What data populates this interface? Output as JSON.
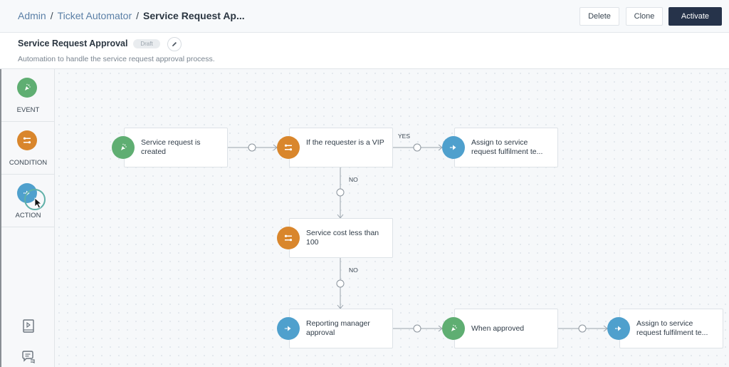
{
  "breadcrumb": {
    "items": [
      "Admin",
      "Ticket Automator"
    ],
    "separator": "/",
    "current": "Service Request Ap..."
  },
  "toolbar": {
    "delete_label": "Delete",
    "clone_label": "Clone",
    "activate_label": "Activate"
  },
  "automation": {
    "title": "Service Request Approval",
    "status_badge": "Draft",
    "description": "Automation to handle the service request approval process."
  },
  "palette": {
    "items": [
      {
        "label": "EVENT",
        "icon": "event-icon",
        "color": "#5fae72"
      },
      {
        "label": "CONDITION",
        "icon": "condition-icon",
        "color": "#d9862c"
      },
      {
        "label": "ACTION",
        "icon": "action-icon",
        "color": "#4fa0cd"
      }
    ],
    "bottom_icons": [
      "playbook-icon",
      "chat-icon"
    ]
  },
  "flow": {
    "nodes": [
      {
        "id": "n1",
        "type": "event",
        "text": "Service request is created"
      },
      {
        "id": "n2",
        "type": "condition",
        "text": "If the requester is a VIP"
      },
      {
        "id": "n3",
        "type": "action",
        "text": "Assign to service request fulfilment te..."
      },
      {
        "id": "n4",
        "type": "condition",
        "text": "Service cost less than 100"
      },
      {
        "id": "n5",
        "type": "action",
        "text": "Reporting manager approval"
      },
      {
        "id": "n6",
        "type": "event",
        "text": "When approved"
      },
      {
        "id": "n7",
        "type": "action",
        "text": "Assign to service request fulfilment te..."
      }
    ],
    "connector_labels": {
      "yes": "YES",
      "no_1": "NO",
      "no_2": "NO"
    }
  },
  "colors": {
    "event": "#5fae72",
    "condition": "#d9862c",
    "action": "#4fa0cd",
    "primary_button": "#26334a",
    "link": "#5a7fa6"
  }
}
